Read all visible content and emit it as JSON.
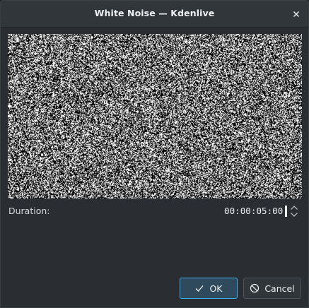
{
  "window": {
    "title": "White Noise — Kdenlive",
    "close_icon": "close-icon"
  },
  "preview": {
    "content": "white-noise"
  },
  "duration": {
    "label": "Duration:",
    "value": "00:00:05:00",
    "spin_icon": "spinbox-arrows-icon"
  },
  "buttons": {
    "ok_label": "OK",
    "ok_icon": "checkmark-icon",
    "cancel_label": "Cancel",
    "cancel_icon": "cancel-icon"
  },
  "colors": {
    "window_bg": "#2a2e32",
    "titlebar_bg": "#31363b",
    "accent": "#3daee9",
    "text": "#eff0f1"
  }
}
